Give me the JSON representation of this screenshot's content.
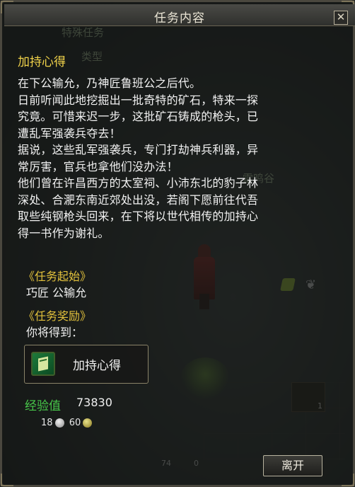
{
  "window": {
    "title": "任务内容"
  },
  "background": {
    "ghost_texts": [
      "特殊任务",
      "类型",
      "雷鸣谷"
    ],
    "slot_counts": [
      "1",
      "74",
      "0"
    ]
  },
  "quest": {
    "title": "加持心得",
    "description": [
      "在下公输允，乃神匠鲁班公之后代。",
      "日前听闻此地挖掘出一批奇特的矿石，特来一探",
      "究竟。可惜来迟一步，这批矿石铸成的枪头，已",
      "遭乱军强袭兵夺去！",
      "据说，这些乱军强袭兵，专门打劫神兵利器，异",
      "常厉害，官兵也拿他们没办法！",
      "他们曾在许昌西方的太室祠、小沛东北的豹子林",
      "深处、合淝东南近郊处出没，若阁下愿前往代吾",
      "取些纯钢枪头回来，在下将以世代相传的加持心",
      "得一书作为谢礼。"
    ],
    "start_section": {
      "title": "《任务起始》",
      "npc": "巧匠 公输允"
    },
    "reward_section": {
      "title": "《任务奖励》",
      "intro": "你将得到：",
      "item_name": "加持心得",
      "item_icon": "green-book-icon",
      "exp_label": "经验值",
      "exp_value": "73830",
      "silver": "18",
      "copper": "60"
    }
  },
  "buttons": {
    "leave": "离开",
    "close": "✕"
  }
}
